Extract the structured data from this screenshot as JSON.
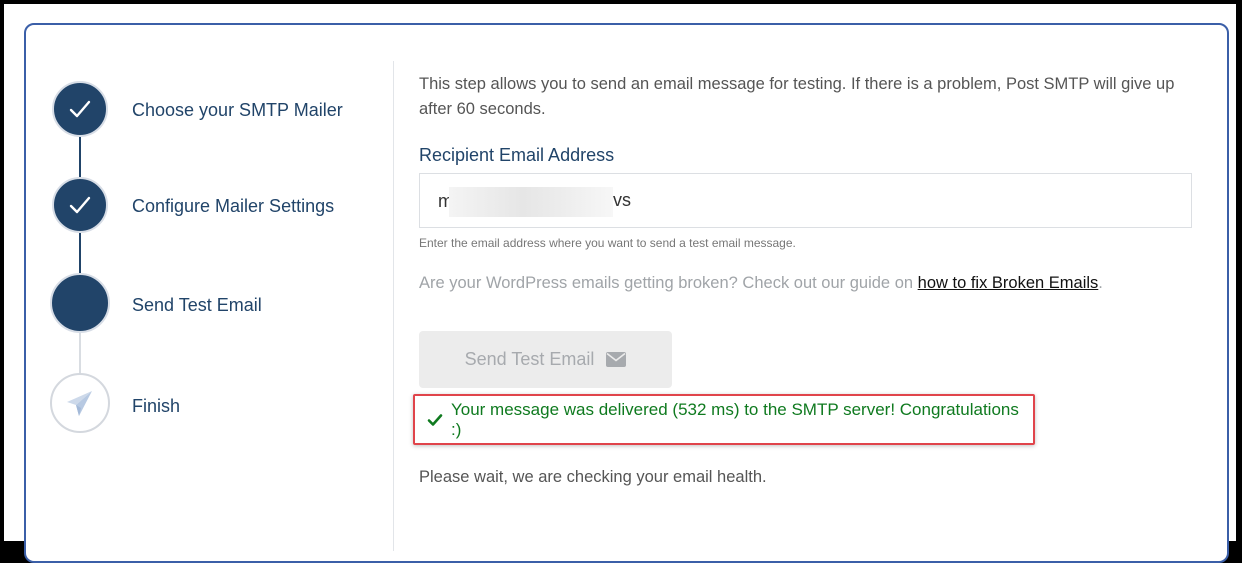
{
  "steps": [
    {
      "label": "Choose your SMTP Mailer",
      "state": "done",
      "icon": "check-icon"
    },
    {
      "label": "Configure Mailer Settings",
      "state": "done",
      "icon": "check-icon"
    },
    {
      "label": "Send Test Email",
      "state": "current",
      "icon": ""
    },
    {
      "label": "Finish",
      "state": "pending",
      "icon": "paper-plane-icon"
    }
  ],
  "intro_text": "This step allows you to send an email message for testing. If there is a problem, Post SMTP will give up after 60 seconds.",
  "recipient": {
    "label": "Recipient Email Address",
    "value_prefix": "m",
    "value_suffix": "vs",
    "help": "Enter the email address where you want to send a test email message."
  },
  "broken_emails": {
    "text": "Are your WordPress emails getting broken? Check out our guide on ",
    "link": "how to fix Broken Emails",
    "trailing": "."
  },
  "send_button": {
    "label": "Send Test Email",
    "icon": "envelope-icon"
  },
  "success": {
    "icon": "check-icon",
    "message": "Your message was delivered (532 ms) to the SMTP server! Congratulations :)"
  },
  "status_text": "Please wait, we are checking your email health.",
  "colors": {
    "primary": "#214469",
    "card_border": "#3b5fa8",
    "success_text": "#0f7a1f",
    "highlight_border": "#e0444b"
  }
}
